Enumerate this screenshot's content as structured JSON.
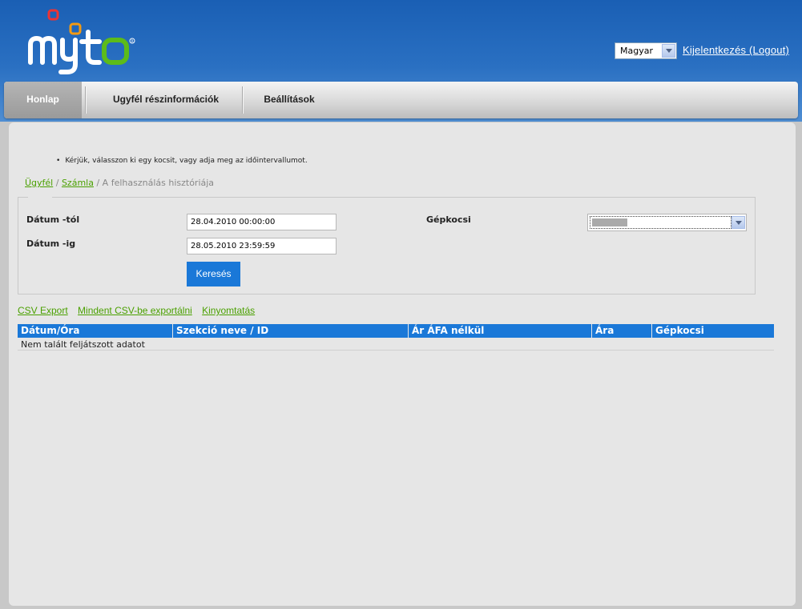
{
  "header": {
    "logo_text": "myto",
    "language": "Magyar",
    "logout": "Kijelentkezés (Logout)"
  },
  "nav": {
    "tabs": [
      {
        "label": "Honlap",
        "active": true
      },
      {
        "label": "Ugyfél részinformációk",
        "active": false
      },
      {
        "label": "Beállítások",
        "active": false
      }
    ]
  },
  "notice": "Kérjük, válasszon ki egy kocsit, vagy adja meg az időintervallumot.",
  "breadcrumb": {
    "items": [
      "Ügyfél",
      "Számla",
      "A felhasználás hisztóriája"
    ]
  },
  "form": {
    "date_from_label": "Dátum -tól",
    "date_from_value": "28.04.2010 00:00:00",
    "date_to_label": "Dátum -ig",
    "date_to_value": "28.05.2010 23:59:59",
    "car_label": "Gépkocsi",
    "search_label": "Keresés"
  },
  "links": {
    "csv_export": "CSV Export",
    "export_all": "Mindent CSV-be exportálni",
    "print": "Kinyomtatás"
  },
  "table": {
    "columns": [
      "Dátum/Óra",
      "Szekció neve / ID",
      "Ár ÁFA nélkül",
      "Ára",
      "Gépkocsi"
    ],
    "empty_message": "Nem talált feljátszott adatot"
  },
  "colors": {
    "header_blue": "#1a5fb4",
    "accent_blue": "#1a78d8",
    "link_green": "#4aa000"
  }
}
